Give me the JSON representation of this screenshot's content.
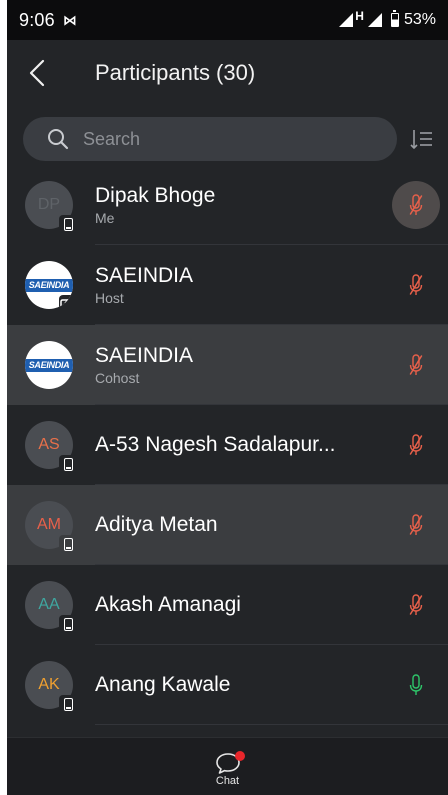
{
  "status_bar": {
    "time": "9:06",
    "app_icon": "⋈",
    "network": "H",
    "battery": "53%"
  },
  "header": {
    "title": "Participants (30)"
  },
  "search": {
    "placeholder": "Search"
  },
  "participants": [
    {
      "name": "Dipak Bhoge",
      "role": "Me",
      "initials": "DP",
      "initials_color": "#5f6368",
      "avatar": "initials",
      "badge": "phone",
      "mic": "muted",
      "mic_color": "#e8604a",
      "highlighted": false
    },
    {
      "name": "SAEINDIA",
      "role": "Host",
      "avatar": "logo",
      "logo_text": "SAEINDIA",
      "badge": "share",
      "mic": "muted",
      "mic_color": "#e8604a",
      "highlighted": false
    },
    {
      "name": "SAEINDIA",
      "role": "Cohost",
      "avatar": "logo",
      "logo_text": "SAEINDIA",
      "badge": "none",
      "mic": "muted",
      "mic_color": "#e8604a",
      "highlighted": true
    },
    {
      "name": "A-53 Nagesh Sadalapur...",
      "role": "",
      "initials": "AS",
      "initials_color": "#e8704a",
      "avatar": "initials",
      "badge": "phone",
      "mic": "muted",
      "mic_color": "#e8604a",
      "highlighted": false
    },
    {
      "name": "Aditya Metan",
      "role": "",
      "initials": "AM",
      "initials_color": "#e8604a",
      "avatar": "initials",
      "badge": "phone",
      "mic": "muted",
      "mic_color": "#e8604a",
      "highlighted": true
    },
    {
      "name": "Akash Amanagi",
      "role": "",
      "initials": "AA",
      "initials_color": "#3fa7a0",
      "avatar": "initials",
      "badge": "phone",
      "mic": "muted",
      "mic_color": "#e8604a",
      "highlighted": false
    },
    {
      "name": "Anang Kawale",
      "role": "",
      "initials": "AK",
      "initials_color": "#f0a030",
      "avatar": "initials",
      "badge": "phone",
      "mic": "unmuted",
      "mic_color": "#2ec76a",
      "highlighted": false
    }
  ],
  "bottom_bar": {
    "chat_label": "Chat",
    "chat_unread": true
  }
}
